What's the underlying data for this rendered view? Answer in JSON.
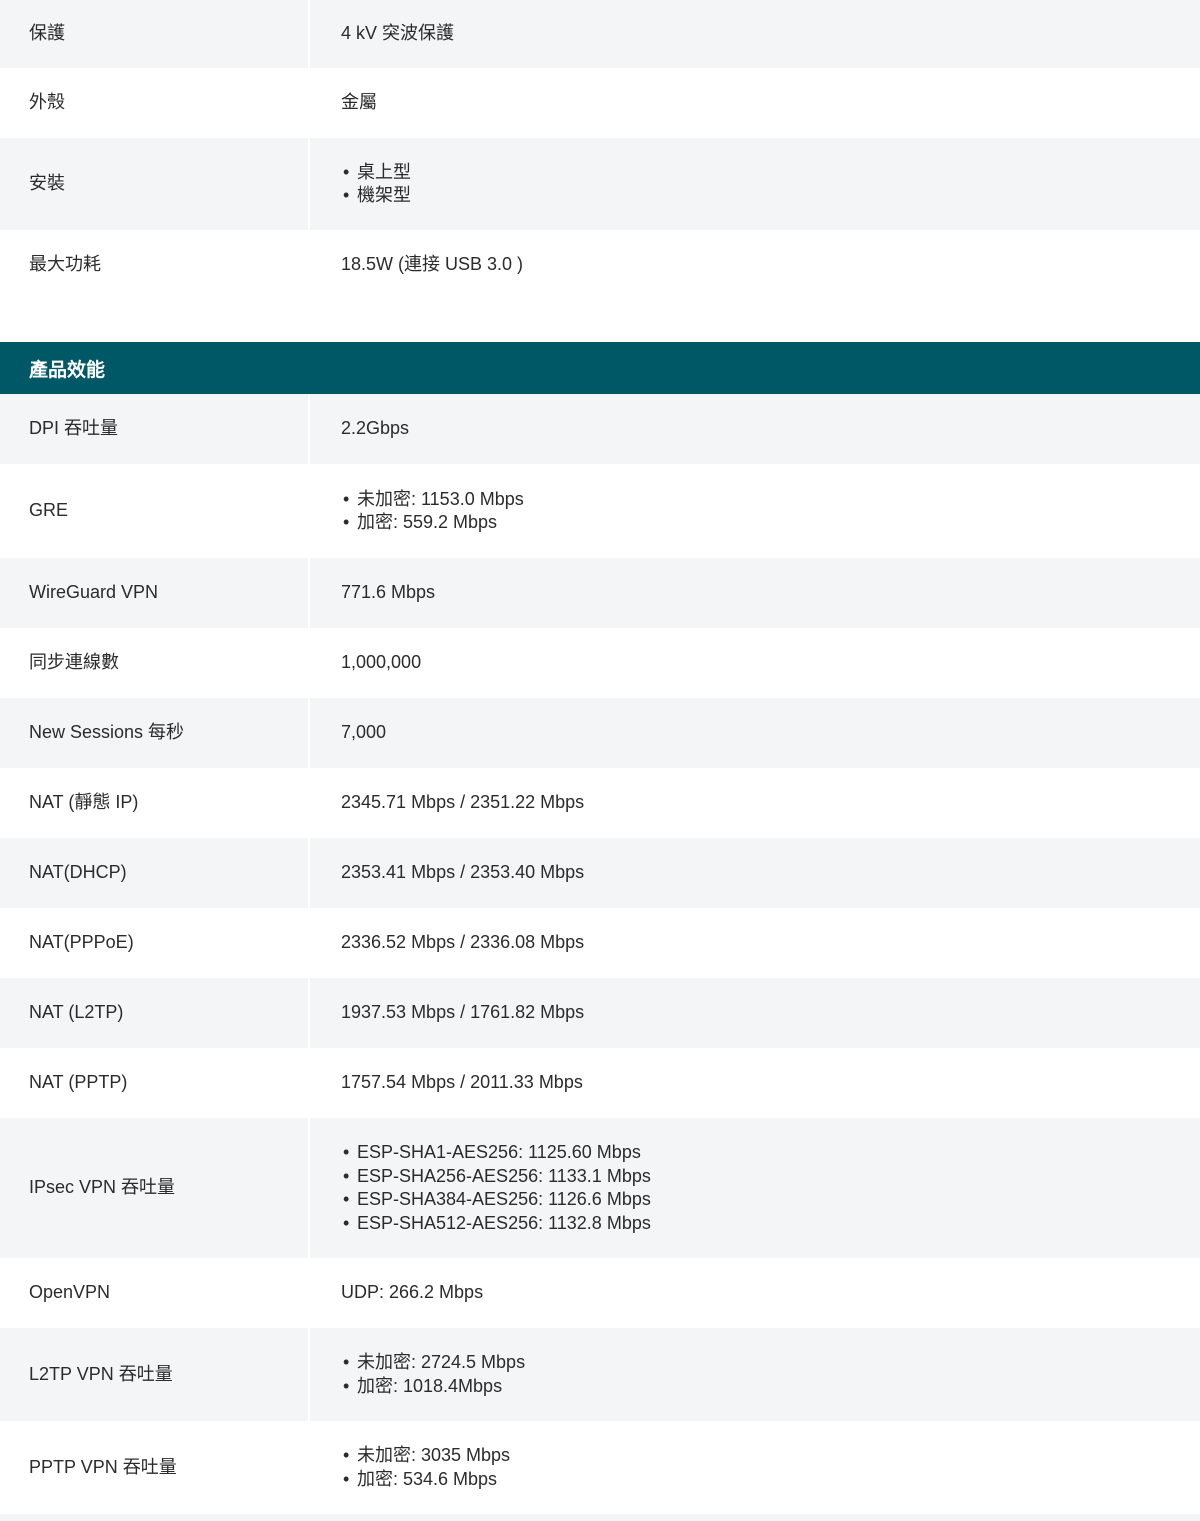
{
  "top_rows": [
    {
      "label": "保護",
      "value": "4 kV 突波保護"
    },
    {
      "label": "外殼",
      "value": "金屬"
    },
    {
      "label": "安裝",
      "bullets": [
        "桌上型",
        "機架型"
      ]
    },
    {
      "label": "最大功耗",
      "value": "18.5W (連接 USB 3.0 )"
    }
  ],
  "section": {
    "title": "產品效能"
  },
  "perf_rows": [
    {
      "label": "DPI 吞吐量",
      "value": "2.2Gbps"
    },
    {
      "label": "GRE",
      "bullets": [
        "未加密: 1153.0 Mbps",
        "加密: 559.2 Mbps"
      ]
    },
    {
      "label": "WireGuard VPN",
      "value": "771.6 Mbps"
    },
    {
      "label": "同步連線數",
      "value": "1,000,000"
    },
    {
      "label": "New Sessions 每秒",
      "value": "7,000"
    },
    {
      "label": "NAT (靜態 IP)",
      "value": "2345.71 Mbps / 2351.22 Mbps"
    },
    {
      "label": "NAT(DHCP)",
      "value": "2353.41 Mbps / 2353.40 Mbps"
    },
    {
      "label": "NAT(PPPoE)",
      "value": "2336.52 Mbps / 2336.08 Mbps"
    },
    {
      "label": "NAT (L2TP)",
      "value": "1937.53 Mbps / 1761.82 Mbps"
    },
    {
      "label": "NAT (PPTP)",
      "value": "1757.54 Mbps / 2011.33 Mbps"
    },
    {
      "label": "IPsec VPN 吞吐量",
      "bullets": [
        "ESP-SHA1-AES256: 1125.60 Mbps",
        "ESP-SHA256-AES256: 1133.1 Mbps",
        "ESP-SHA384-AES256: 1126.6 Mbps",
        "ESP-SHA512-AES256: 1132.8 Mbps"
      ]
    },
    {
      "label": "OpenVPN",
      "value": "UDP: 266.2 Mbps"
    },
    {
      "label": "L2TP VPN 吞吐量",
      "bullets": [
        "未加密: 2724.5 Mbps",
        "加密: 1018.4Mbps"
      ]
    },
    {
      "label": "PPTP VPN 吞吐量",
      "bullets": [
        "未加密: 3035 Mbps",
        "加密: 534.6 Mbps"
      ]
    }
  ]
}
